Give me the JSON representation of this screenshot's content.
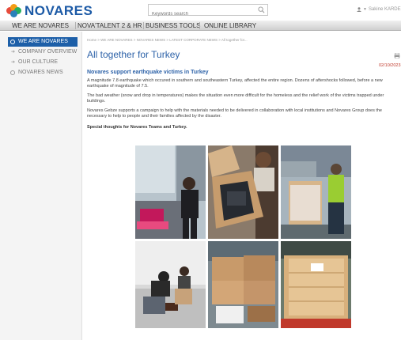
{
  "brand": {
    "name": "NOVARES",
    "colors": {
      "primary": "#1c5aa6",
      "accent": "#2d62a8",
      "date": "#c0392b"
    }
  },
  "search": {
    "placeholder": "Keywords search"
  },
  "user": {
    "name": "Sakine KARDE"
  },
  "nav": {
    "items": [
      {
        "label": "WE ARE NOVARES"
      },
      {
        "label": "NOVA'TALENT 2 & HR"
      },
      {
        "label": "BUSINESS TOOLS"
      },
      {
        "label": "ONLINE LIBRARY"
      }
    ]
  },
  "sidebar": {
    "items": [
      {
        "label": "WE ARE NOVARES"
      },
      {
        "label": "COMPANY OVERVIEW"
      },
      {
        "label": "OUR CULTURE"
      },
      {
        "label": "NOVARES NEWS"
      }
    ]
  },
  "breadcrumb": "Home > WE ARE NOVARES > NOVARES NEWS > LATEST CORPORATE NEWS > All together for...",
  "article": {
    "title": "All together for Turkey",
    "date": "02/10/2023",
    "subtitle": "Novares support earthquake victims in Turkey",
    "paragraphs": [
      "A magnitude 7.8 earthquake which occured in southern and southeastern Turkey, affected the entire region. Dozens of aftershocks followed, before a new earthquake of magnitude of 7.5.",
      "The bad weather (snow and drop in temperatures) makes the situation even more difficult for the homeless and the relief work of the victims trapped under buildings.",
      "Novares Gebze supports a campaign to help with the materials needed to be delivered in collaboration with local institutions and Novares Group does the necessary to help to people and their families affected by the disaster."
    ],
    "closing": "Special thoughts for Novares Teams and Turkey."
  }
}
